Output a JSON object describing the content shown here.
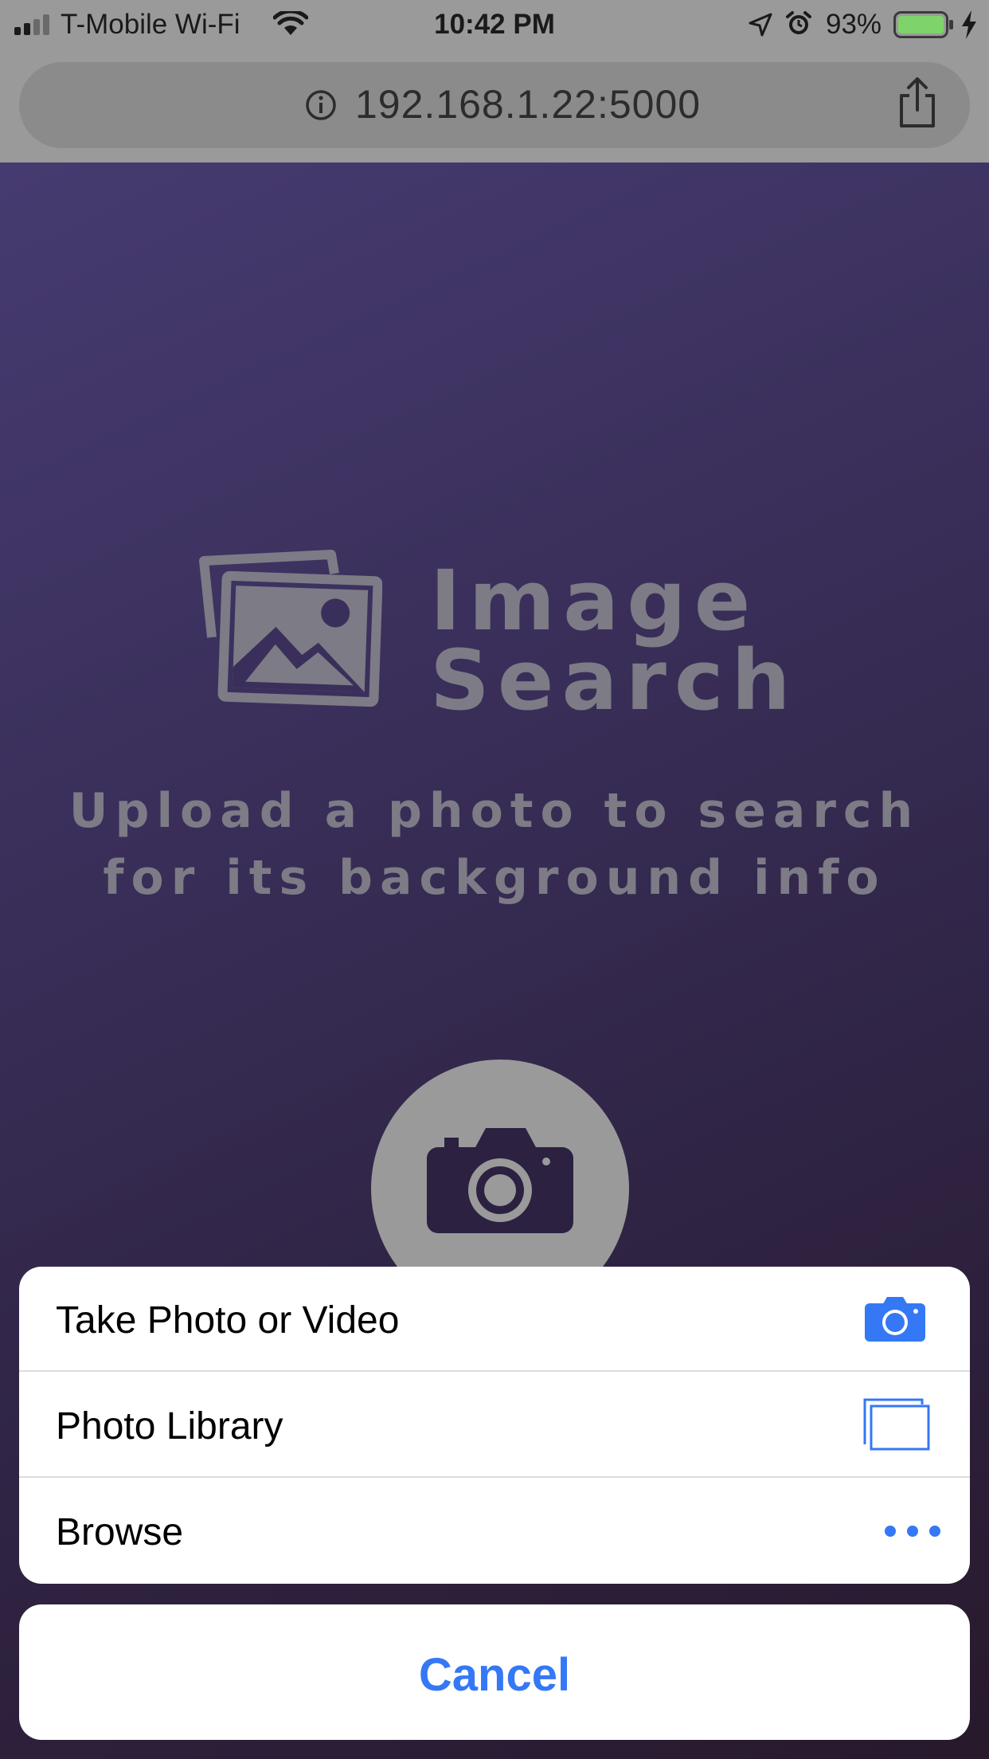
{
  "status_bar": {
    "carrier": "T-Mobile Wi-Fi",
    "time": "10:42 PM",
    "battery_percent": "93%"
  },
  "browser": {
    "url": "192.168.1.22:5000"
  },
  "page": {
    "title_line1": "Image",
    "title_line2": "Search",
    "subtitle_line1": "Upload a photo to search",
    "subtitle_line2": "for its background info"
  },
  "action_sheet": {
    "options": [
      {
        "label": "Take Photo or Video",
        "icon": "camera-icon"
      },
      {
        "label": "Photo Library",
        "icon": "photo-library-icon"
      },
      {
        "label": "Browse",
        "icon": "more-icon"
      }
    ],
    "cancel_label": "Cancel"
  },
  "colors": {
    "accent": "#3478f6",
    "page_gradient_start": "#463b70",
    "page_gradient_end": "#28192c",
    "logo_text": "#7d7b86"
  }
}
